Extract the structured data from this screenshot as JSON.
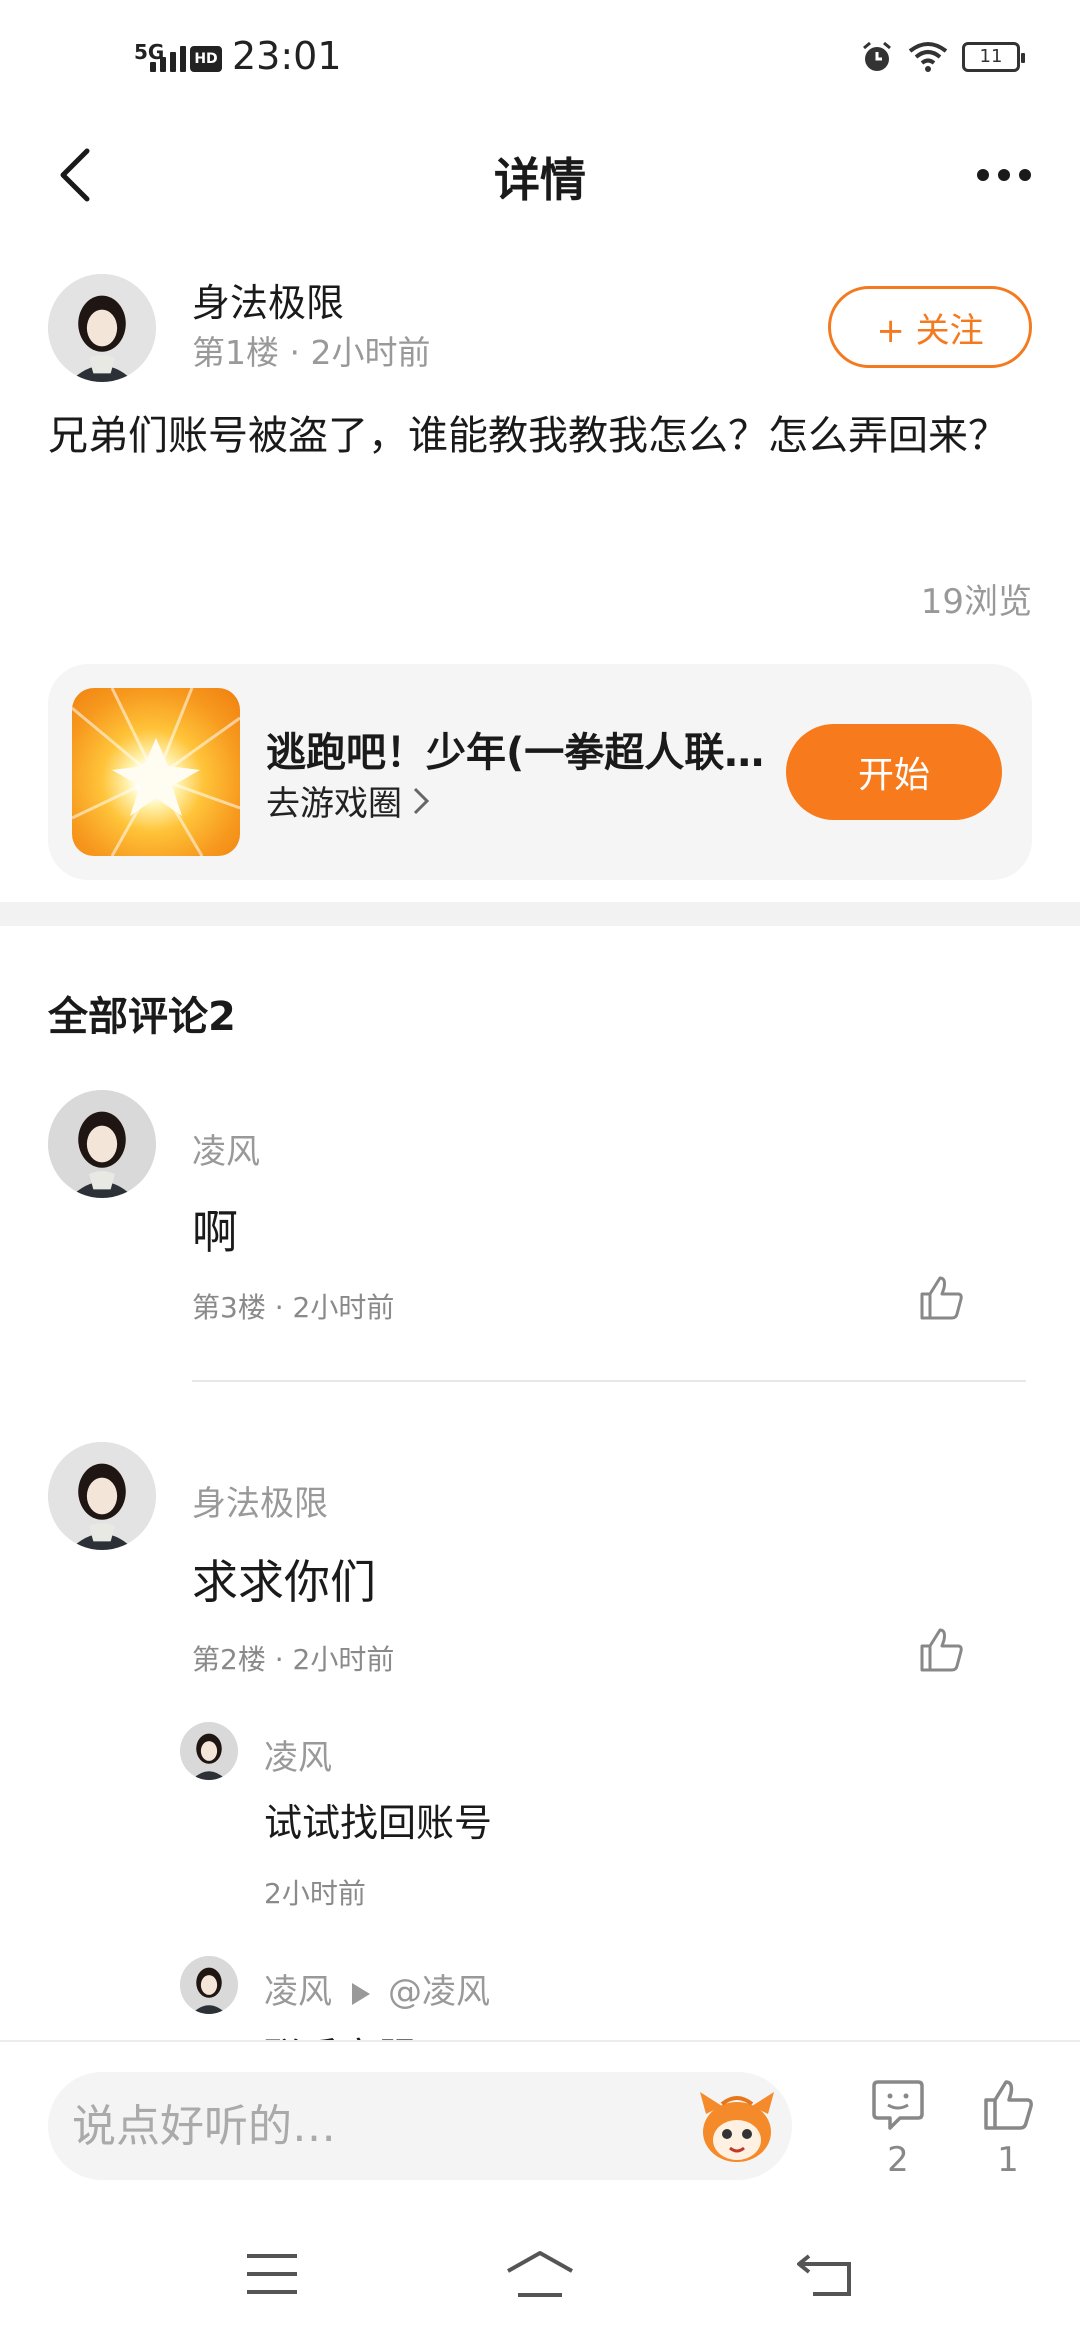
{
  "status_bar": {
    "network": "5G",
    "hd": "HD",
    "time": "23:01",
    "battery": "11"
  },
  "header": {
    "title": "详情"
  },
  "post": {
    "author": "身法极限",
    "meta": "第1楼 · 2小时前",
    "follow_label": "+ 关注",
    "content": "兄弟们账号被盗了，谁能教我教我怎么？怎么弄回来？",
    "views": "19浏览"
  },
  "game": {
    "name": "逃跑吧！少年(一拳超人联动)",
    "link_label": "去游戏圈",
    "start_label": "开始"
  },
  "comments_section": {
    "title": "全部评论2",
    "items": [
      {
        "author": "凌风",
        "text": "啊",
        "meta": "第3楼 · 2小时前"
      },
      {
        "author": "身法极限",
        "text": "求求你们",
        "meta": "第2楼 · 2小时前",
        "replies": [
          {
            "author": "凌风",
            "text": "试试找回账号",
            "meta": "2小时前"
          },
          {
            "author": "凌风",
            "reply_to": "@凌风",
            "text": "联系客服"
          }
        ]
      }
    ]
  },
  "bottom_bar": {
    "placeholder": "说点好听的…",
    "comment_count": "2",
    "like_count": "1"
  },
  "colors": {
    "accent": "#f77a1c",
    "text": "#1a1a1a",
    "muted": "#999999"
  },
  "icons": [
    "back-icon",
    "more-icon",
    "plus-icon",
    "chevron-right-icon",
    "thumb-up-icon",
    "comment-icon",
    "mascot-icon",
    "menu-icon",
    "home-icon",
    "return-icon"
  ]
}
